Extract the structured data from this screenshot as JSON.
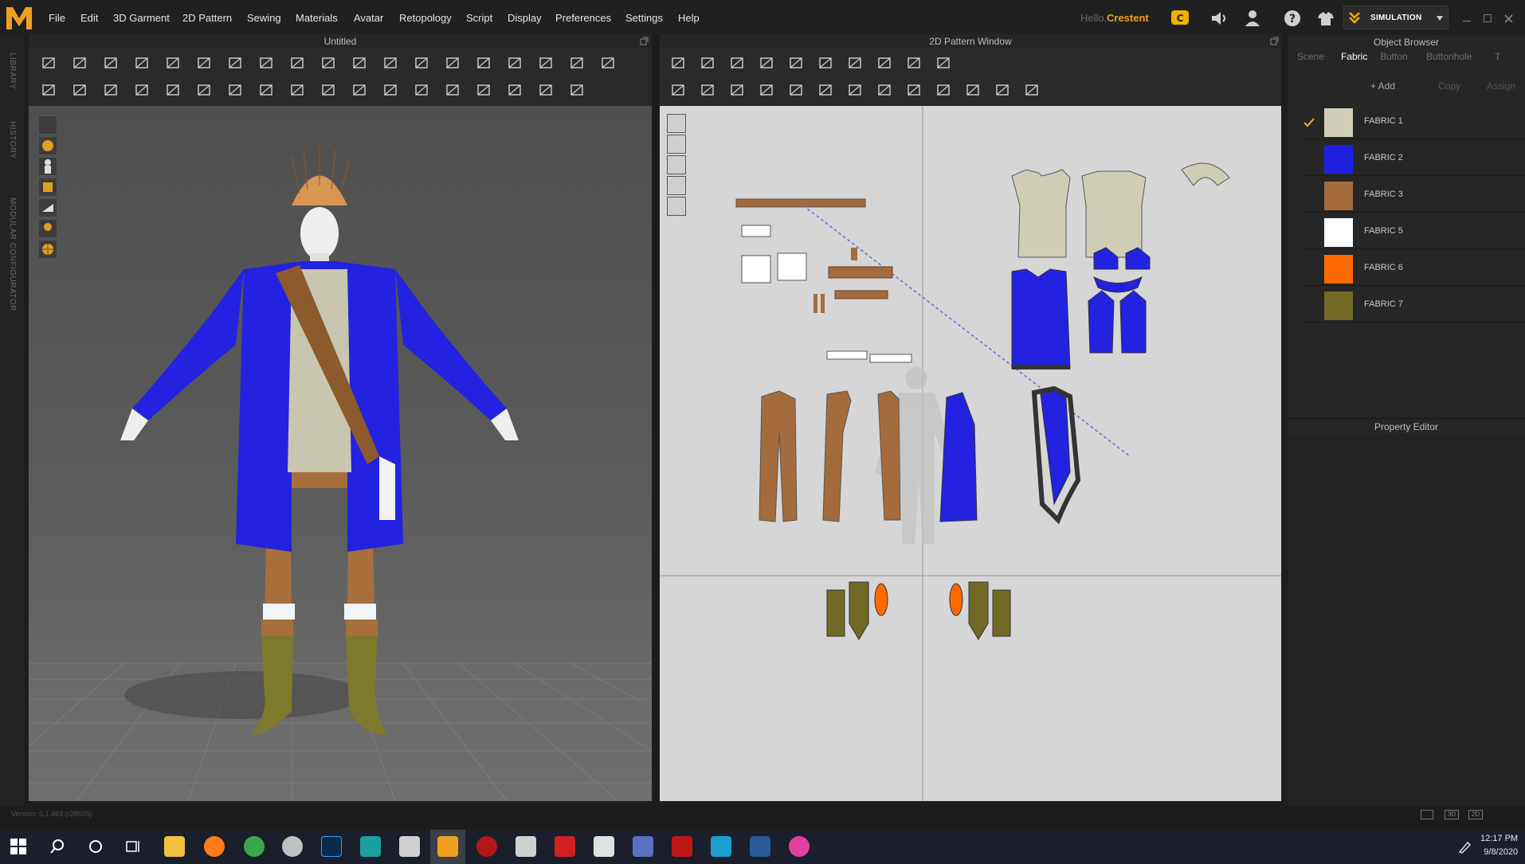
{
  "menubar": {
    "items": [
      "File",
      "Edit",
      "3D Garment",
      "2D Pattern",
      "Sewing",
      "Materials",
      "Avatar",
      "Retopology",
      "Script",
      "Display",
      "Preferences",
      "Settings",
      "Help"
    ],
    "hello": "Hello,",
    "username": "Crestent",
    "mode": "SIMULATION"
  },
  "left_tabs": [
    "LIBRARY",
    "HISTORY",
    "MODULAR CONFIGURATOR"
  ],
  "panels": {
    "viewport3d_title": "Untitled",
    "viewport2d_title": "2D Pattern Window",
    "object_browser_title": "Object Browser",
    "property_editor_title": "Property Editor"
  },
  "object_browser": {
    "tabs": [
      "Scene",
      "Fabric",
      "Button",
      "Buttonhole",
      "T"
    ],
    "active_tab": "Fabric",
    "actions": [
      "+ Add",
      "Copy",
      "Assign"
    ],
    "fabrics": [
      {
        "name": "FABRIC 1",
        "color": "#cfcdb6",
        "checked": true
      },
      {
        "name": "FABRIC 2",
        "color": "#1f1fe0",
        "checked": false
      },
      {
        "name": "FABRIC 3",
        "color": "#a46c3c",
        "checked": false
      },
      {
        "name": "FABRIC 5",
        "color": "#ffffff",
        "checked": false
      },
      {
        "name": "FABRIC 6",
        "color": "#ff6a00",
        "checked": false
      },
      {
        "name": "FABRIC 7",
        "color": "#706a24",
        "checked": false
      }
    ]
  },
  "status": {
    "version": "Version: 5.1.463 (r28695)"
  },
  "taskbar": {
    "time": "12:17 PM",
    "date": "9/8/2020"
  },
  "colors": {
    "accent": "#f0a020",
    "fabric_blue": "#1f1fe0",
    "fabric_brown": "#a46c3c",
    "fabric_olive": "#706a24"
  }
}
